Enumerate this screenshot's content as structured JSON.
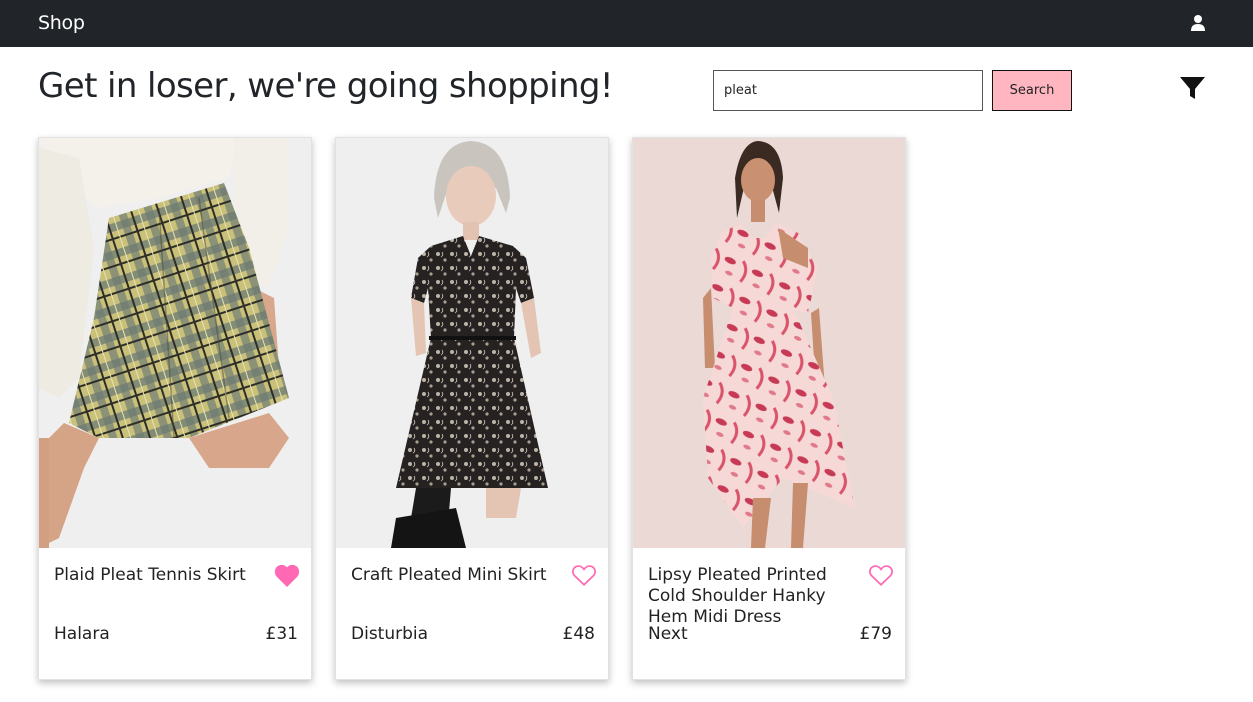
{
  "navbar": {
    "brand": "Shop",
    "user_icon": "user-icon"
  },
  "header": {
    "title": "Get in loser, we're going shopping!",
    "search": {
      "value": "pleat",
      "placeholder": "",
      "button_label": "Search"
    },
    "filter_icon": "filter-icon"
  },
  "colors": {
    "navbar_bg": "#212529",
    "search_button_bg": "#ffb6c1",
    "favorite_pink": "#ff69b4"
  },
  "products": [
    {
      "name": "Plaid Pleat Tennis Skirt",
      "brand": "Halara",
      "price": "£31",
      "favorited": true,
      "image": "plaid-skirt-photo"
    },
    {
      "name": "Craft Pleated Mini Skirt",
      "brand": "Disturbia",
      "price": "£48",
      "favorited": false,
      "image": "black-floral-dress-photo"
    },
    {
      "name": "Lipsy Pleated Printed Cold Shoulder Hanky Hem Midi Dress",
      "brand": "Next",
      "price": "£79",
      "favorited": false,
      "image": "pink-floral-dress-photo"
    }
  ]
}
